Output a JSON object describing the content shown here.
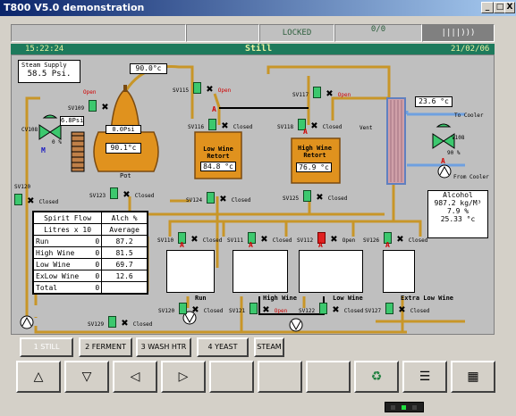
{
  "window": {
    "title": "T800 V5.0 demonstration",
    "min": "_",
    "max": "□",
    "close": "X"
  },
  "topbar": {
    "locked": "LOCKED",
    "counter": "0/0",
    "logo": "||||)))"
  },
  "status": {
    "time": "15:22:24",
    "title": "Still",
    "date": "21/02/06"
  },
  "steam_supply": {
    "label": "Steam Supply",
    "value": "58.5 Psi."
  },
  "still": {
    "temp_top": "90.0°c",
    "pressure_left": "6.8Psi",
    "pressure_pot": "0.0Psi",
    "temp_pot": "90.1°c",
    "pot_label": "Pot",
    "cv108": "CV108",
    "cv_percent": "0 %",
    "cv_mode": "M"
  },
  "retorts": {
    "low": {
      "name": "Low Wine Retort",
      "temp": "84.8 °c"
    },
    "high": {
      "name": "High Wine Retort",
      "temp": "76.9 °c"
    }
  },
  "condenser": {
    "temp": "23.6 °c",
    "vent": "Vent",
    "to_cooler": "To Cooler",
    "from_cooler": "From Cooler",
    "v108": "V108",
    "percent": "90 %",
    "mode": "A"
  },
  "alcohol": {
    "title": "Alcohol",
    "density": "987.2 kg/M³",
    "percent": "7.9 %",
    "temp": "25.33 °c"
  },
  "valves": {
    "sv115": "SV115",
    "sv116": "SV116",
    "sv117": "SV117",
    "sv118": "SV118",
    "sv109": "SV109",
    "sv123": "SV123",
    "sv124": "SV124",
    "sv125": "SV125",
    "sv120a": "SV120",
    "sv110": "SV110",
    "sv111": "SV111",
    "sv112": "SV112",
    "sv126": "SV126",
    "sv120b": "SV120",
    "sv121": "SV121",
    "sv122": "SV122",
    "sv127": "SV127",
    "sv129": "SV129"
  },
  "states": {
    "open": "Open",
    "closed": "Closed",
    "a": "A"
  },
  "spirit_flow": {
    "header1": "Spirit Flow",
    "header2": "Litres x 10",
    "header3": "Alch %",
    "header4": "Average",
    "rows": [
      {
        "name": "Run",
        "litres": "0",
        "alch": "87.2"
      },
      {
        "name": "High Wine",
        "litres": "0",
        "alch": "81.5"
      },
      {
        "name": "Low Wine",
        "litres": "0",
        "alch": "69.7"
      },
      {
        "name": "ExLow Wine",
        "litres": "0",
        "alch": "12.6"
      },
      {
        "name": "Total",
        "litres": "0",
        "alch": ""
      }
    ]
  },
  "tanks": {
    "run": "Run",
    "high": "High Wine",
    "low": "Low Wine",
    "exlow": "Extra Low Wine"
  },
  "nav": [
    "1 STILL",
    "2 FERMENT",
    "3 WASH HTR",
    "4 YEAST",
    "STEAM"
  ],
  "bottom_buttons": [
    "△",
    "▽",
    "◁",
    "▷",
    "",
    "",
    "",
    "♻",
    "☰",
    "▦"
  ]
}
